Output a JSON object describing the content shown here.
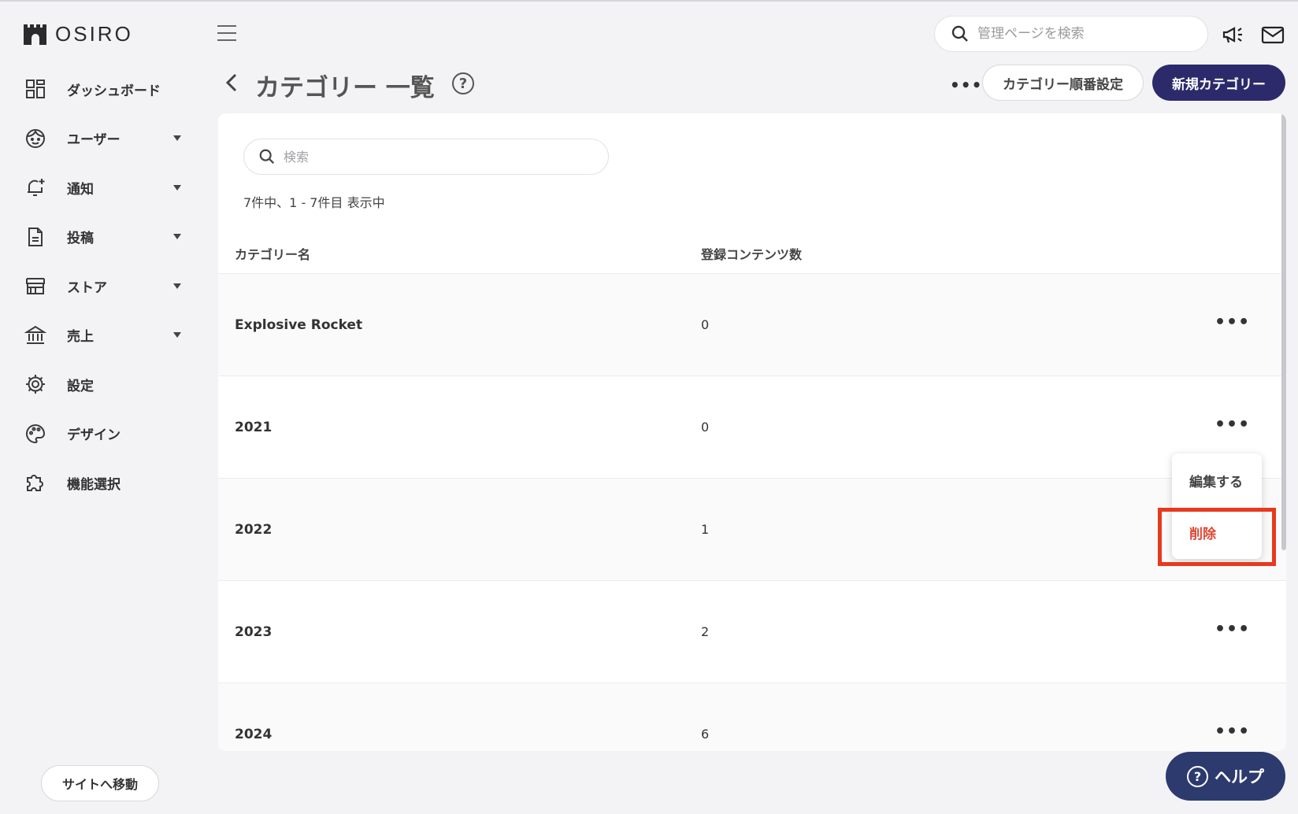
{
  "brand": {
    "name": "OSIRO"
  },
  "sidebar": {
    "items": [
      {
        "label": "ダッシュボード",
        "icon": "dashboard-icon",
        "has_caret": false
      },
      {
        "label": "ユーザー",
        "icon": "user-face-icon",
        "has_caret": true
      },
      {
        "label": "通知",
        "icon": "bell-plus-icon",
        "has_caret": true
      },
      {
        "label": "投稿",
        "icon": "document-icon",
        "has_caret": true
      },
      {
        "label": "ストア",
        "icon": "store-icon",
        "has_caret": true
      },
      {
        "label": "売上",
        "icon": "bank-icon",
        "has_caret": true
      },
      {
        "label": "設定",
        "icon": "gear-icon",
        "has_caret": false
      },
      {
        "label": "デザイン",
        "icon": "palette-icon",
        "has_caret": false
      },
      {
        "label": "機能選択",
        "icon": "puzzle-icon",
        "has_caret": false
      }
    ],
    "site_button": "サイトへ移動"
  },
  "header": {
    "search_placeholder": "管理ページを検索",
    "icons": [
      "megaphone-icon",
      "mail-icon"
    ]
  },
  "page": {
    "title": "カテゴリー 一覧",
    "more": "•••",
    "order_button": "カテゴリー順番設定",
    "new_button": "新規カテゴリー"
  },
  "list": {
    "search_placeholder": "検索",
    "count_text": "7件中、1 - 7件目 表示中",
    "columns": {
      "name": "カテゴリー名",
      "count": "登録コンテンツ数"
    },
    "rows": [
      {
        "name": "Explosive Rocket",
        "count": "0"
      },
      {
        "name": "2021",
        "count": "0"
      },
      {
        "name": "2022",
        "count": "1"
      },
      {
        "name": "2023",
        "count": "2"
      },
      {
        "name": "2024",
        "count": "6"
      }
    ],
    "row_menu": "•••"
  },
  "context_menu": {
    "edit": "編集する",
    "delete": "削除"
  },
  "help": {
    "label": "ヘルプ",
    "symbol": "?"
  },
  "colors": {
    "primary": "#2c2a6b",
    "danger": "#e04632",
    "highlight": "#e8391e"
  }
}
